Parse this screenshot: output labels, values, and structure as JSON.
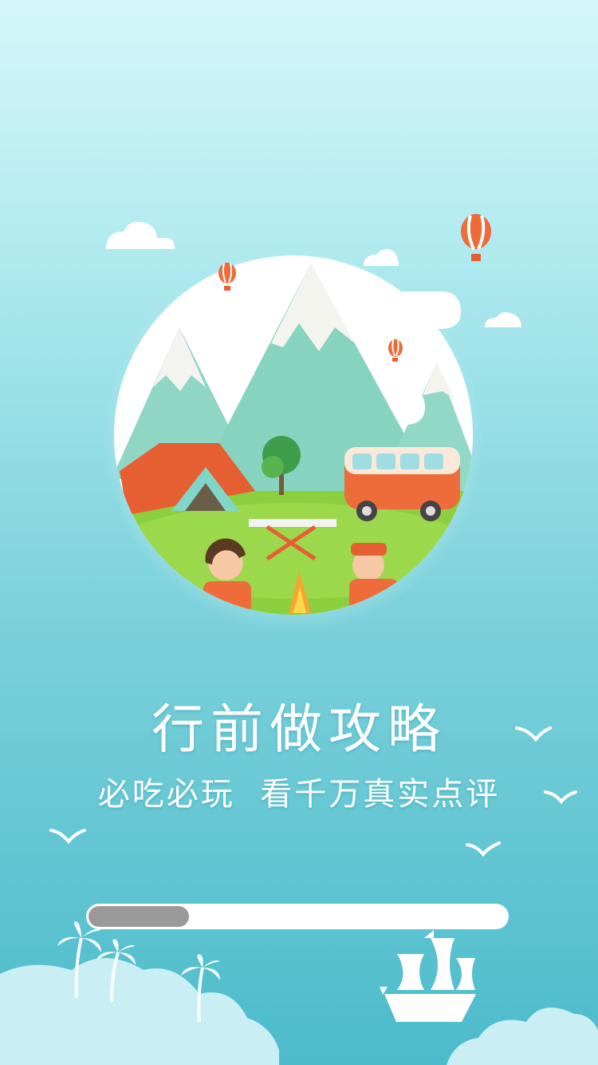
{
  "splash": {
    "headline": "行前做攻略",
    "subline": "必吃必玩  看千万真实点评"
  },
  "progress": {
    "value": 0.24
  },
  "illustration": {
    "subject": "camping scene with mountains, tent, camper van and campfire",
    "icons": [
      "hot-air-balloon-icon",
      "cloud-icon",
      "seagull-icon",
      "palm-tree-icon",
      "sailing-ship-icon"
    ]
  },
  "colors": {
    "background_top": "#d6f6fa",
    "background_bottom": "#4cbbcb",
    "text": "#ffffff",
    "progress_track": "#ffffff",
    "progress_fill": "#9a9a9a",
    "accent_orange": "#ee6b3a"
  }
}
